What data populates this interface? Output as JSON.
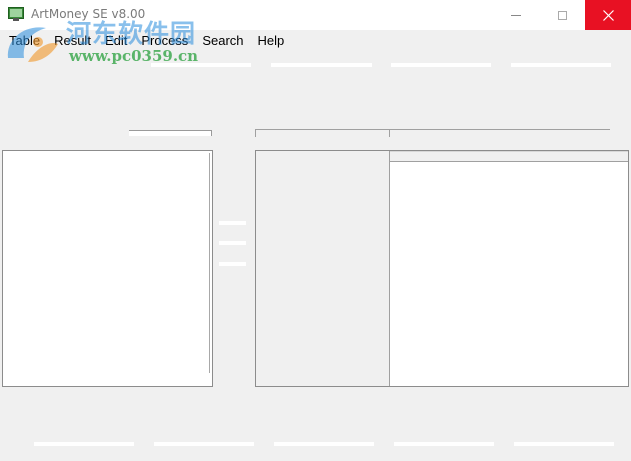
{
  "window": {
    "title": "ArtMoney SE v8.00",
    "close_color": "#e81123"
  },
  "watermark": {
    "chinese_text": "河东软件园",
    "url": "www.pc0359.cn"
  },
  "menu": {
    "items": [
      {
        "label": "Table"
      },
      {
        "label": "Result"
      },
      {
        "label": "Edit"
      },
      {
        "label": "Process"
      },
      {
        "label": "Search"
      },
      {
        "label": "Help"
      }
    ]
  }
}
